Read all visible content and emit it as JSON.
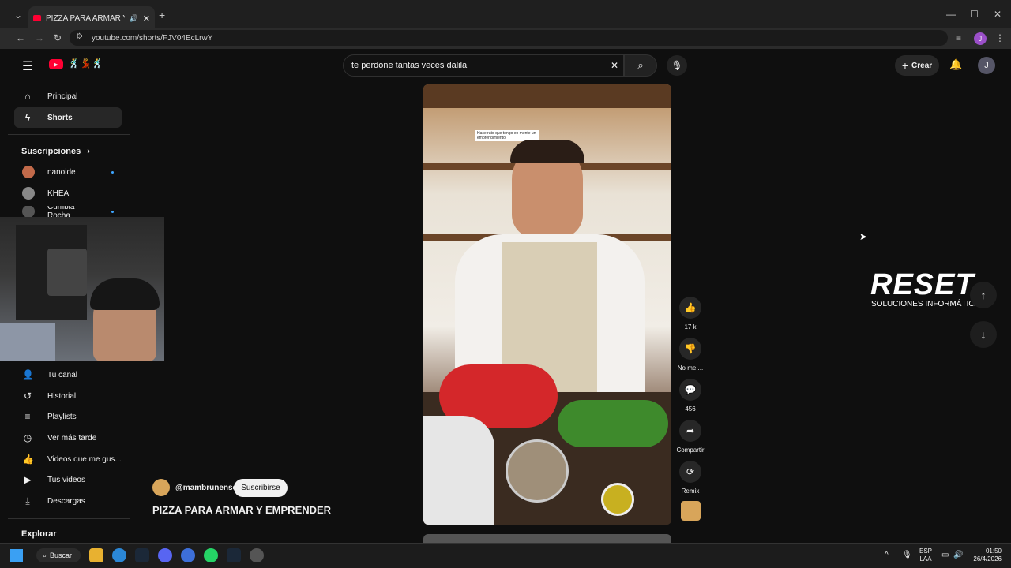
{
  "browser": {
    "tab_title": "PIZZA PARA ARMAR Y EMPR",
    "url": "youtube.com/shorts/FJV04EcLrwY",
    "profile_initial": "J"
  },
  "header": {
    "search_value": "te perdone tantas veces dalila",
    "create_label": "Crear",
    "avatar_initial": "J"
  },
  "sidebar": {
    "items": [
      {
        "label": "Principal",
        "icon": "home-icon"
      },
      {
        "label": "Shorts",
        "icon": "shorts-icon"
      }
    ],
    "subscriptions_title": "Suscripciones",
    "subscriptions": [
      {
        "name": "nanoide"
      },
      {
        "name": "KHEA"
      },
      {
        "name": "Cumbia Rocha"
      }
    ],
    "you_items": [
      {
        "label": "Tu canal"
      },
      {
        "label": "Historial"
      },
      {
        "label": "Playlists"
      },
      {
        "label": "Ver más tarde"
      },
      {
        "label": "Videos que me gus..."
      },
      {
        "label": "Tus videos"
      },
      {
        "label": "Descargas"
      }
    ],
    "explore_title": "Explorar"
  },
  "short": {
    "channel": "@mambrunense",
    "subscribe_label": "Suscribirse",
    "title": "PIZZA PARA ARMAR Y EMPRENDER",
    "overlay_text": "Hace rato que tengo en mente un emprendimiento",
    "likes": "17 k",
    "dislike_label": "No me ...",
    "comments": "456",
    "share_label": "Compartir",
    "remix_label": "Remix"
  },
  "watermark": {
    "brand": "RESET",
    "tagline": "SOLUCIONES INFORMÁTICAS"
  },
  "taskbar": {
    "search_label": "Buscar",
    "lang_top": "ESP",
    "lang_bottom": "LAA",
    "time": "01:50",
    "date": "26/4/2026"
  },
  "colors": {
    "accent_red": "#ff0033",
    "bg": "#0f0f0f",
    "subscribe_bg": "#f1f1f1"
  }
}
